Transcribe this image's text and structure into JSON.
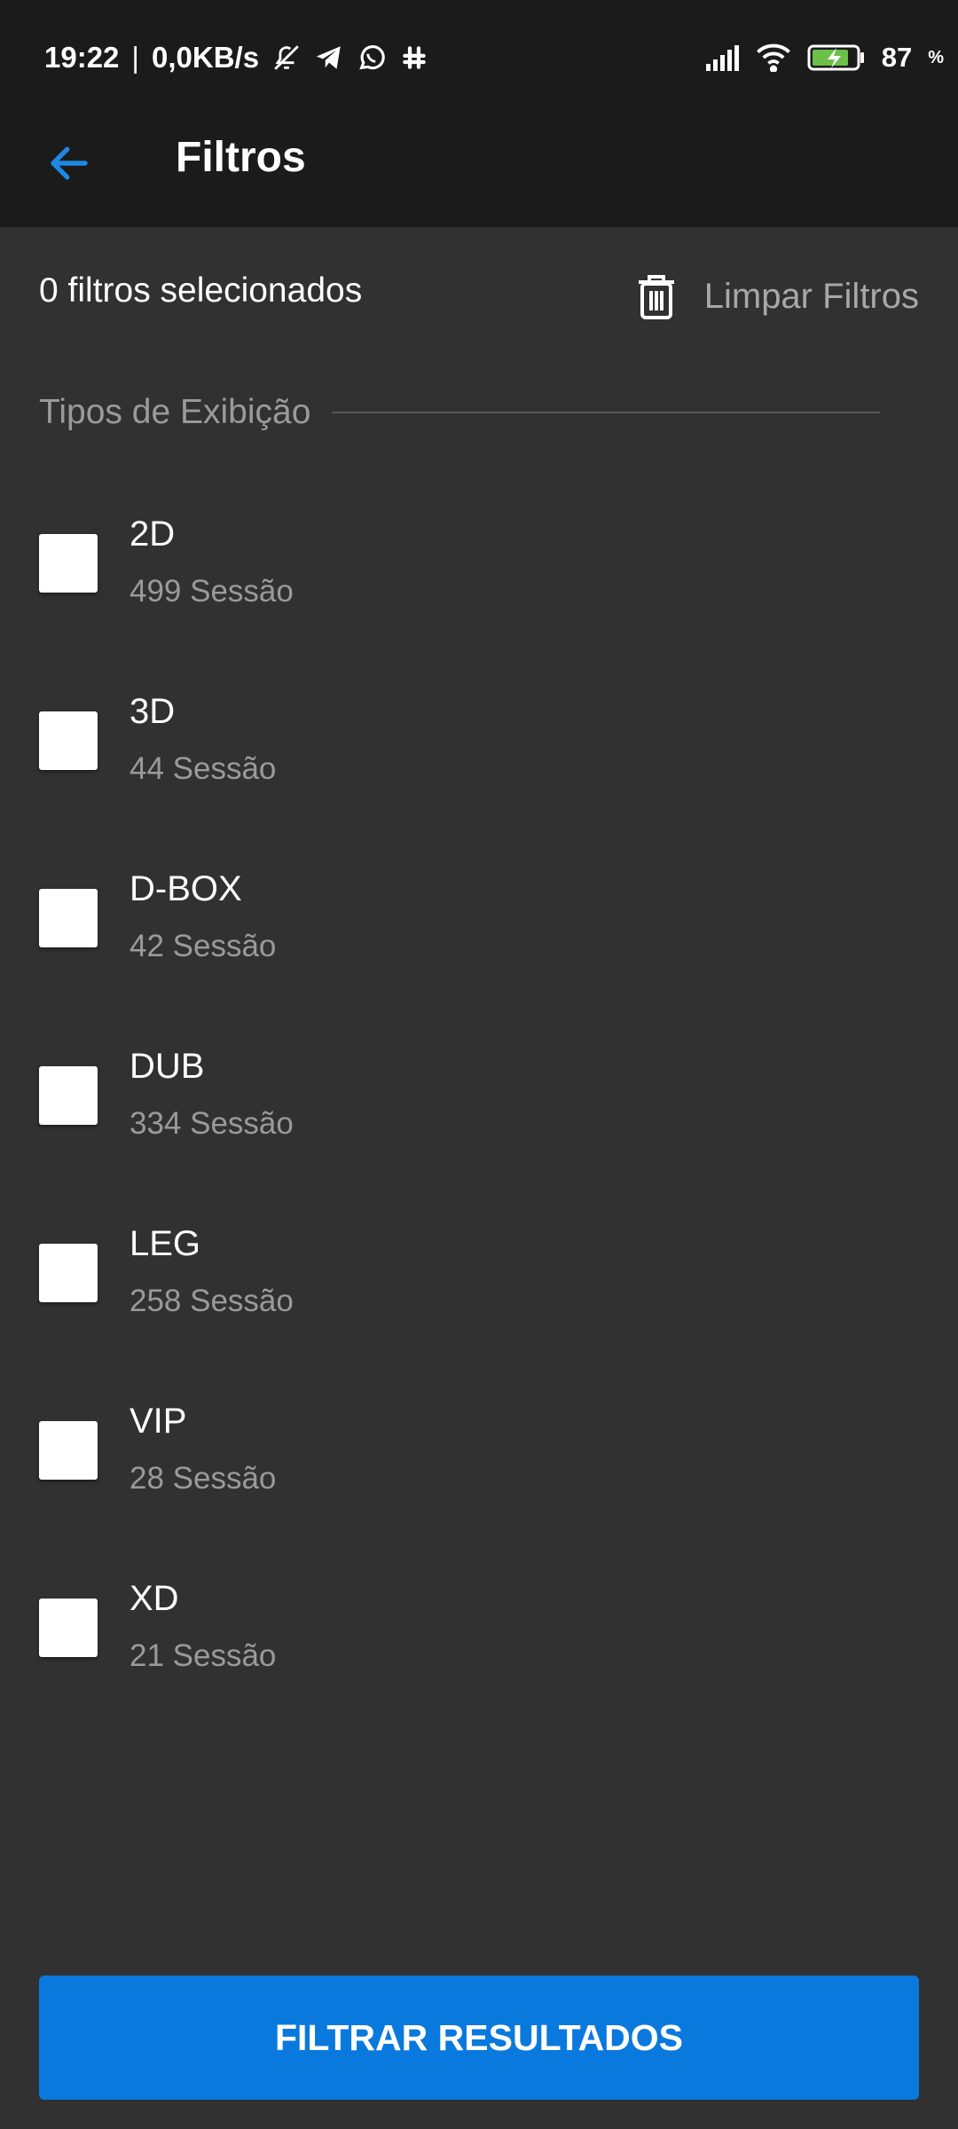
{
  "status_bar": {
    "time": "19:22",
    "separator": "|",
    "network_speed": "0,0KB/s",
    "battery_percent": "87",
    "battery_unit": "%",
    "icons": [
      "bell-off-icon",
      "telegram-icon",
      "whatsapp-icon",
      "slack-icon",
      "signal-icon",
      "wifi-icon",
      "battery-charging-icon"
    ]
  },
  "app_bar": {
    "title": "Filtros",
    "back_icon": "arrow-left-icon",
    "accent_color": "#1e88e5"
  },
  "summary": {
    "selected_count_text": "0 filtros selecionados",
    "clear_label": "Limpar Filtros",
    "clear_icon": "trash-icon"
  },
  "section": {
    "title": "Tipos de Exibição"
  },
  "filters": [
    {
      "label": "2D",
      "count": "499 Sessão",
      "checked": false
    },
    {
      "label": "3D",
      "count": "44 Sessão",
      "checked": false
    },
    {
      "label": "D-BOX",
      "count": "42 Sessão",
      "checked": false
    },
    {
      "label": "DUB",
      "count": "334 Sessão",
      "checked": false
    },
    {
      "label": "LEG",
      "count": "258 Sessão",
      "checked": false
    },
    {
      "label": "VIP",
      "count": "28 Sessão",
      "checked": false
    },
    {
      "label": "XD",
      "count": "21 Sessão",
      "checked": false
    }
  ],
  "footer": {
    "button_label": "FILTRAR RESULTADOS",
    "button_color": "#0a79dd"
  }
}
